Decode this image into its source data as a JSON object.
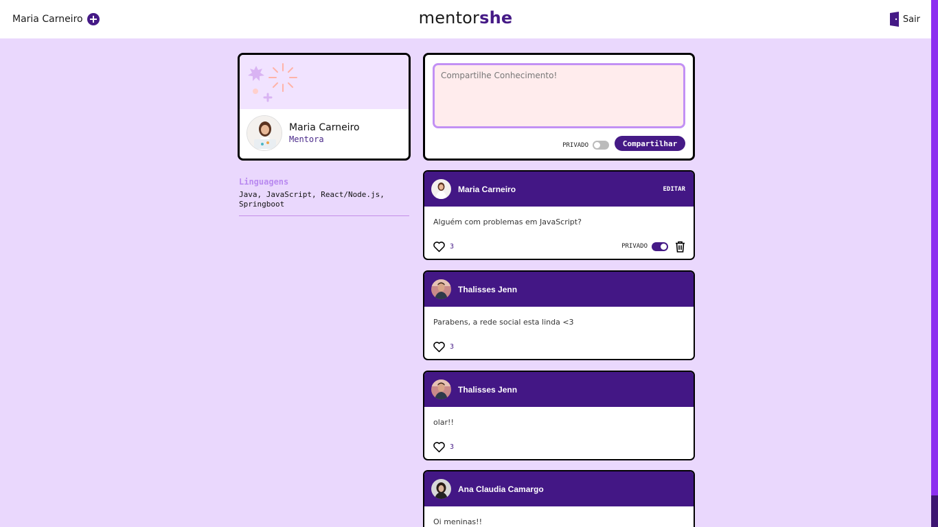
{
  "header": {
    "user_name": "Maria Carneiro",
    "brand_part1": "mentor",
    "brand_part2": "she",
    "logout_label": "Sair"
  },
  "profile": {
    "name": "Maria Carneiro",
    "role": "Mentora",
    "languages_title": "Linguagens",
    "languages": "Java, JavaScript, React/Node.js, Springboot"
  },
  "compose": {
    "placeholder": "Compartilhe Conhecimento!",
    "private_label": "PRIVADO",
    "share_label": "Compartilhar"
  },
  "posts": [
    {
      "author": "Maria Carneiro",
      "edit_label": "EDITAR",
      "text": "Alguém com problemas em JavaScript?",
      "likes": "3",
      "private_label": "PRIVADO"
    },
    {
      "author": "Thalisses Jenn",
      "text": "Parabens, a rede social esta linda <3",
      "likes": "3"
    },
    {
      "author": "Thalisses Jenn",
      "text": "olar!!",
      "likes": "3"
    },
    {
      "author": "Ana Claudia Camargo",
      "text": "Oi meninas!!"
    }
  ],
  "colors": {
    "background": "#ead8fd",
    "primary": "#431785",
    "accent": "#c290f4"
  },
  "icons": [
    "plus-icon",
    "door-icon",
    "heart-icon",
    "trash-icon"
  ]
}
